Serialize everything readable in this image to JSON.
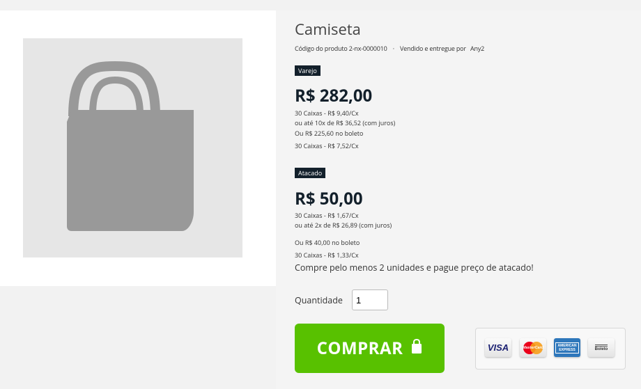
{
  "product": {
    "title": "Camiseta",
    "code_label": "Código do produto",
    "code": "2-nx-0000010",
    "separator": "·",
    "sold_by_label": "Vendido e entregue por",
    "seller": "Any2"
  },
  "image": {
    "icon": "shopping-bag-placeholder-icon",
    "bg_color": "#e6e6e6",
    "icon_color": "#999999"
  },
  "retail": {
    "badge": "Varejo",
    "price": "R$ 282,00",
    "lines": [
      "30 Caixas - R$ 9,40/Cx",
      "ou até 10x de R$ 36,52 (com juros)",
      "Ou R$ 225,60 no boleto",
      "30 Caixas - R$ 7,52/Cx"
    ]
  },
  "wholesale": {
    "badge": "Atacado",
    "price": "R$ 50,00",
    "lines": [
      "30 Caixas - R$ 1,67/Cx",
      "ou até 2x de R$ 26,89 (com juros)",
      "Ou R$ 40,00 no boleto",
      "30 Caixas - R$ 1,33/Cx"
    ],
    "note": "Compre pelo menos 2 unidades e pague preço de atacado!"
  },
  "quantity": {
    "label": "Quantidade",
    "value": "1"
  },
  "buy_button": {
    "label": "COMPRAR",
    "icon": "shopping-bag-icon",
    "color": "#58c100"
  },
  "payments": [
    {
      "name": "visa",
      "label": "VISA",
      "icon": "visa-icon"
    },
    {
      "name": "mastercard",
      "label": "MasterCard",
      "icon": "mastercard-icon"
    },
    {
      "name": "amex",
      "label": "AMERICAN EXPRESS",
      "icon": "amex-icon"
    },
    {
      "name": "boleto",
      "label": "Boleto",
      "icon": "boleto-icon"
    }
  ],
  "colors": {
    "dark": "#13202b",
    "accent_green": "#58c100"
  }
}
